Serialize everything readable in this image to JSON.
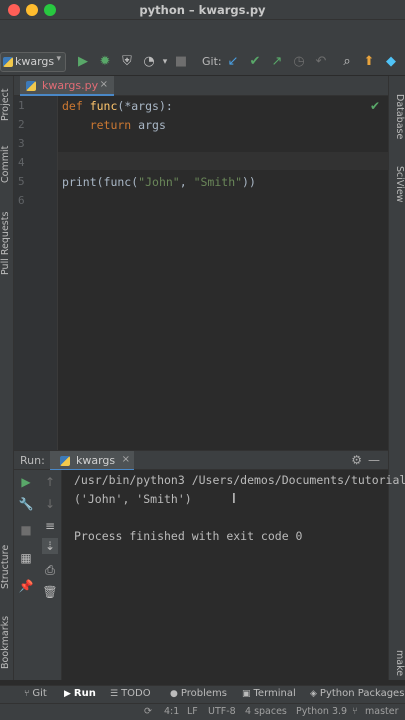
{
  "window": {
    "title": "python – kwargs.py"
  },
  "toolbar": {
    "run_config": "kwargs",
    "git_label": "Git:"
  },
  "left_tabs": {
    "project": "Project",
    "commit": "Commit",
    "pull_requests": "Pull Requests",
    "structure": "Structure",
    "bookmarks": "Bookmarks"
  },
  "right_tabs": {
    "database": "Database",
    "sciview": "SciView",
    "make": "make"
  },
  "editor": {
    "tab_name": "kwargs.py",
    "line_numbers": [
      "1",
      "2",
      "3",
      "4",
      "5",
      "6"
    ],
    "lines": {
      "l1_kw": "def",
      "l1_fn": " func",
      "l1_rest": "(*args):",
      "l2_kw": "    return",
      "l2_rest": " args",
      "l5_a": "print(func(",
      "l5_s1": "\"John\"",
      "l5_b": ", ",
      "l5_s2": "\"Smith\"",
      "l5_c": "))"
    }
  },
  "run_panel": {
    "label": "Run:",
    "tab_name": "kwargs",
    "output": [
      "/usr/bin/python3 /Users/demos/Documents/tutorial",
      "('John', 'Smith')",
      "",
      "Process finished with exit code 0"
    ]
  },
  "bottom_tabs": {
    "git": "Git",
    "run": "Run",
    "todo": "TODO",
    "problems": "Problems",
    "terminal": "Terminal",
    "python_packages": "Python Packages"
  },
  "status_bar": {
    "position": "4:1",
    "line_sep": "LF",
    "encoding": "UTF-8",
    "indent": "4 spaces",
    "interpreter": "Python 3.9",
    "branch": "master"
  }
}
